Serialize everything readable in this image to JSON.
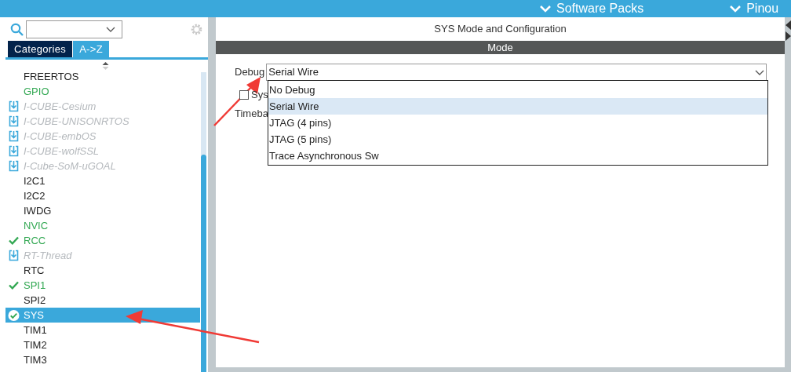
{
  "top_bar": {
    "menus": [
      {
        "label": "Software Packs"
      },
      {
        "label": "Pinou"
      }
    ]
  },
  "tabs": [
    {
      "label": "Categories",
      "selected": false
    },
    {
      "label": "A->Z",
      "selected": true
    }
  ],
  "components": [
    {
      "label": "FREERTOS",
      "kind": "plain",
      "selected": false
    },
    {
      "label": "GPIO",
      "kind": "enabled",
      "selected": false
    },
    {
      "label": "I-CUBE-Cesium",
      "kind": "pack",
      "selected": false
    },
    {
      "label": "I-CUBE-UNISONRTOS",
      "kind": "pack",
      "selected": false
    },
    {
      "label": "I-CUBE-embOS",
      "kind": "pack",
      "selected": false
    },
    {
      "label": "I-CUBE-wolfSSL",
      "kind": "pack",
      "selected": false
    },
    {
      "label": "I-Cube-SoM-uGOAL",
      "kind": "pack",
      "selected": false
    },
    {
      "label": "I2C1",
      "kind": "plain",
      "selected": false
    },
    {
      "label": "I2C2",
      "kind": "plain",
      "selected": false
    },
    {
      "label": "IWDG",
      "kind": "plain",
      "selected": false
    },
    {
      "label": "NVIC",
      "kind": "enabled",
      "selected": false
    },
    {
      "label": "RCC",
      "kind": "configured",
      "selected": false
    },
    {
      "label": "RT-Thread",
      "kind": "pack",
      "selected": false
    },
    {
      "label": "RTC",
      "kind": "plain",
      "selected": false
    },
    {
      "label": "SPI1",
      "kind": "configured",
      "selected": false
    },
    {
      "label": "SPI2",
      "kind": "plain",
      "selected": false
    },
    {
      "label": "SYS",
      "kind": "configured",
      "selected": true
    },
    {
      "label": "TIM1",
      "kind": "plain",
      "selected": false
    },
    {
      "label": "TIM2",
      "kind": "plain",
      "selected": false
    },
    {
      "label": "TIM3",
      "kind": "plain",
      "selected": false
    }
  ],
  "panel": {
    "title": "SYS Mode and Configuration",
    "section": "Mode",
    "debug": {
      "label": "Debug",
      "value": "Serial Wire",
      "options": [
        {
          "label": "No Debug",
          "selected": false
        },
        {
          "label": "Serial Wire",
          "selected": true
        },
        {
          "label": "JTAG (4 pins)",
          "selected": false
        },
        {
          "label": "JTAG (5 pins)",
          "selected": false
        },
        {
          "label": "Trace Asynchronous Sw",
          "selected": false
        }
      ]
    },
    "checkbox": {
      "label": "Sys",
      "checked": false
    },
    "timebase": {
      "label": "Timeba"
    }
  }
}
